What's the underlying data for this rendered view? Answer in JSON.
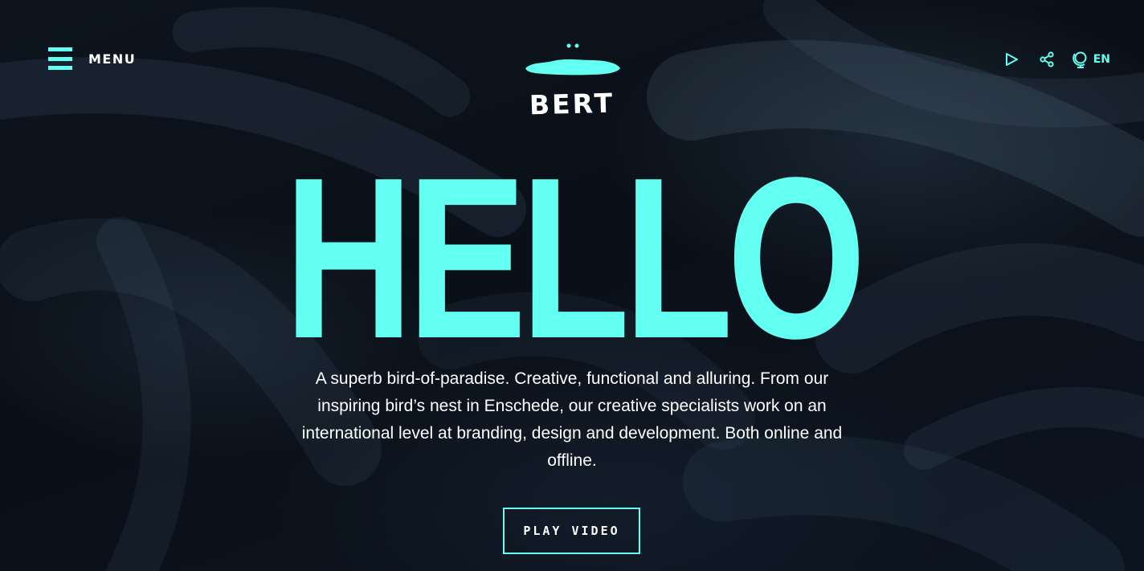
{
  "header": {
    "menu_label": "MENU",
    "logo_text": "BERT",
    "language": "EN",
    "icons": [
      "menu-icon",
      "play-icon",
      "share-icon",
      "globe-icon"
    ]
  },
  "hero": {
    "title": "HELLO",
    "description": "A superb bird-of-paradise. Creative, functional and alluring. From our inspiring bird’s nest in Enschede, our creative specialists work on an international level at branding, design and development. Both online and offline.",
    "cta_label": "PLAY VIDEO"
  },
  "colors": {
    "accent": "#62fff2",
    "background": "#0b1119",
    "text": "#ffffff"
  }
}
